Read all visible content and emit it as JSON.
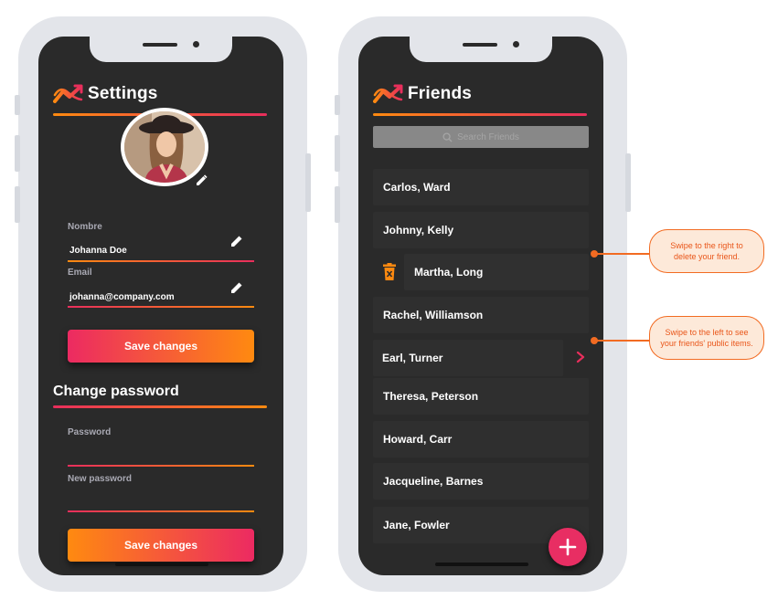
{
  "settings": {
    "title": "Settings",
    "name_label": "Nombre",
    "name_value": "Johanna Doe",
    "email_label": "Email",
    "email_value": "johanna@company.com",
    "save_label": "Save changes",
    "change_password_title": "Change password",
    "password_label": "Password",
    "new_password_label": "New password",
    "save_label_2": "Save changes"
  },
  "friends": {
    "title": "Friends",
    "search_placeholder": "Search Friends",
    "items": [
      "Carlos, Ward",
      "Johnny, Kelly",
      "Martha, Long",
      "Rachel, Williamson",
      "Earl, Turner",
      "Theresa, Peterson",
      "Howard, Carr",
      "Jacqueline, Barnes",
      "Jane, Fowler"
    ]
  },
  "callouts": {
    "swipe_right": "Swipe to the right to delete your friend.",
    "swipe_left": "Swipe to the left to see your friends' public items."
  },
  "icons": {
    "logo": "trend-logo-icon",
    "edit": "pencil-icon",
    "search": "search-icon",
    "delete": "trash-icon",
    "view": "chevron-right-icon",
    "add": "plus-icon"
  },
  "colors": {
    "accent_orange": "#ff8a10",
    "accent_pink": "#e82e5c",
    "screen_bg": "#2a2a2a",
    "callout_border": "#f26b22"
  }
}
